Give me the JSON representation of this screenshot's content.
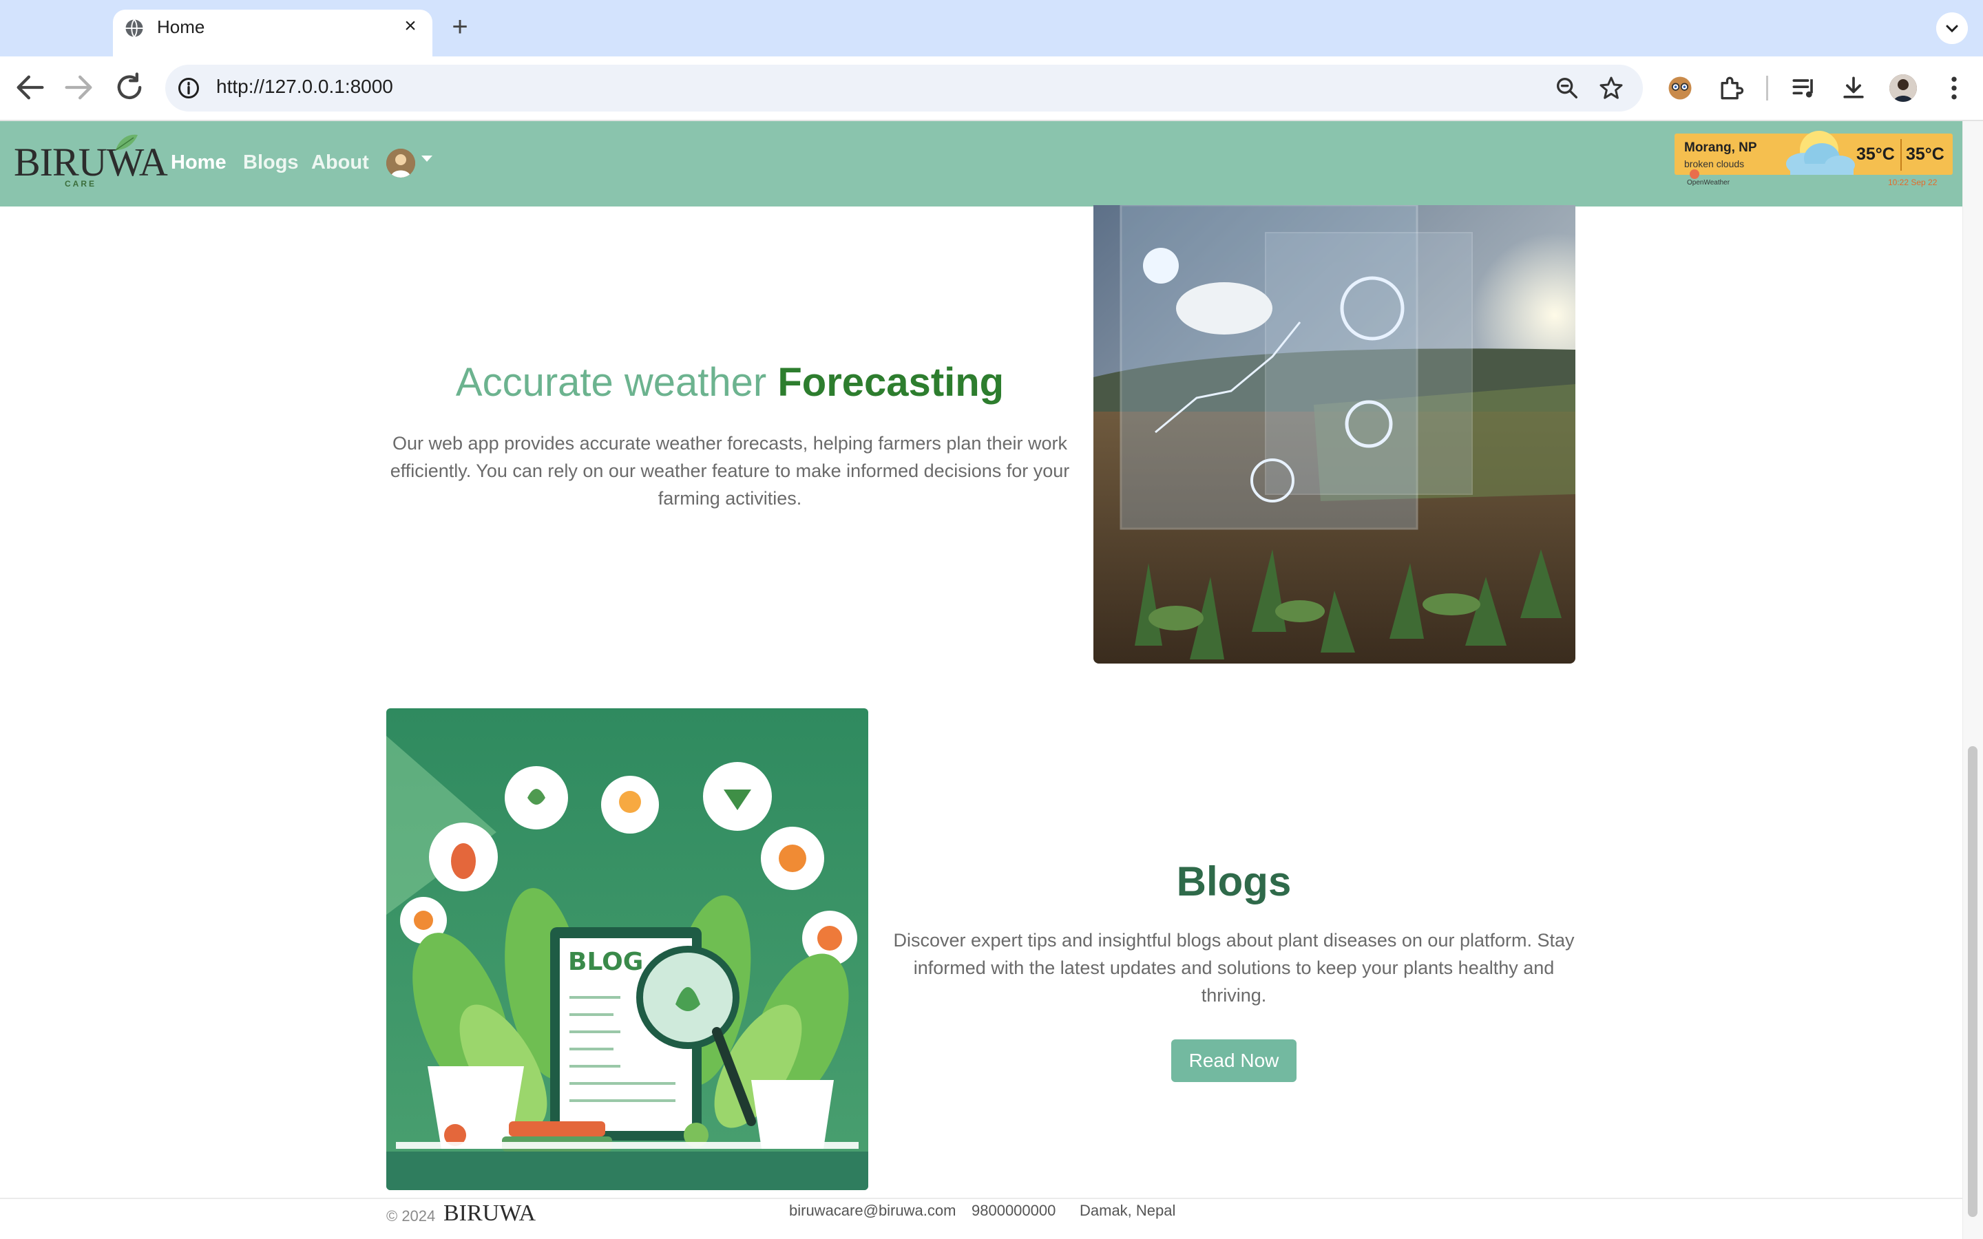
{
  "browser": {
    "tab_title": "Home",
    "url": "http://127.0.0.1:8000"
  },
  "site": {
    "logo_text": "BIRUWA",
    "logo_sub": "CARE",
    "nav": {
      "home": "Home",
      "blogs": "Blogs",
      "about": "About"
    }
  },
  "weather_widget": {
    "location": "Morang, NP",
    "description": "broken clouds",
    "temp_current": "35°C",
    "temp_feels": "35°C",
    "provider": "OpenWeather",
    "time": "10:22 Sep 22"
  },
  "forecast_section": {
    "title_light": "Accurate weather ",
    "title_strong": "Forecasting",
    "text": "Our web app provides accurate weather forecasts, helping farmers plan their work efficiently. You can rely on our weather feature to make informed decisions for your farming activities."
  },
  "blogs_section": {
    "title": "Blogs",
    "text": "Discover expert tips and insightful blogs about plant diseases on our platform. Stay informed with the latest updates and solutions to keep your plants healthy and thriving.",
    "button": "Read Now",
    "image_label": "BLOG"
  },
  "footer": {
    "copyright": "© 2024",
    "logo_text": "BIRUWA",
    "email": "biruwacare@biruwa.com",
    "phone": "9800000000",
    "location": "Damak, Nepal"
  },
  "colors": {
    "navbar": "#8ac4ad",
    "accent": "#2d7d2e",
    "button": "#73b9a0",
    "weather_widget": "#f5bf4f"
  }
}
